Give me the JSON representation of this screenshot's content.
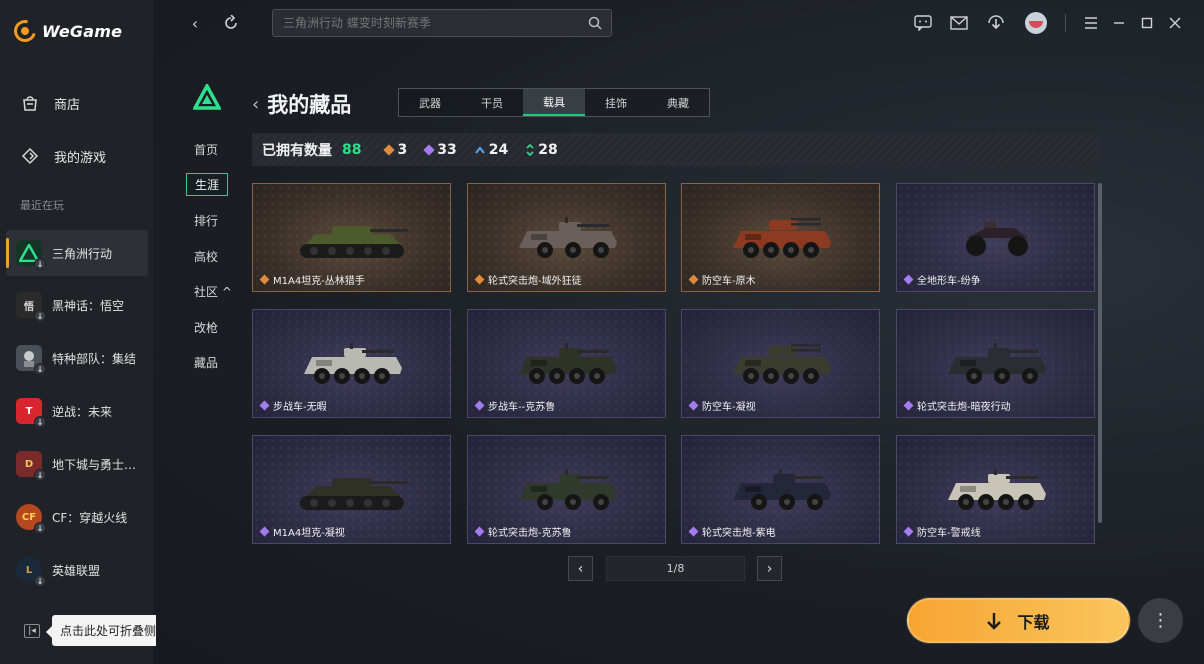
{
  "app": {
    "name": "WeGame"
  },
  "sidebar": {
    "nav": [
      {
        "label": "商店",
        "icon": "store-icon"
      },
      {
        "label": "我的游戏",
        "icon": "controller-icon"
      }
    ],
    "recent_label": "最近在玩",
    "games": [
      {
        "name": "三角洲行动",
        "active": true
      },
      {
        "name": "黑神话：悟空"
      },
      {
        "name": "特种部队：集结"
      },
      {
        "name": "逆战：未来"
      },
      {
        "name": "地下城与勇士：..."
      },
      {
        "name": "CF：穿越火线"
      },
      {
        "name": "英雄联盟"
      }
    ],
    "collapse_tooltip": "点击此处可折叠侧边栏"
  },
  "topbar": {
    "search_placeholder": "三角洲行动 蝶变时刻新赛季"
  },
  "game_nav": {
    "items": [
      "首页",
      "生涯",
      "排行",
      "高校",
      "社区 ^",
      "改枪",
      "藏品"
    ],
    "active": "生涯"
  },
  "collection": {
    "title": "我的藏品",
    "tabs": [
      "武器",
      "干员",
      "载具",
      "挂饰",
      "典藏"
    ],
    "active_tab": "载具",
    "owned_label": "已拥有数量",
    "owned_count": "88",
    "rarity_counts": [
      {
        "value": "3",
        "color": "#e08a3c"
      },
      {
        "value": "33",
        "color": "#a47cf0"
      },
      {
        "value": "24",
        "color": "#5aa8e6"
      },
      {
        "value": "28",
        "color": "#36d08a"
      }
    ],
    "items": [
      {
        "name": "M1A4坦克-丛林猎手",
        "rarity": "gold",
        "vehicle": "tank",
        "paint": "#4c5a2c"
      },
      {
        "name": "轮式突击炮-域外狂徒",
        "rarity": "gold",
        "vehicle": "assault",
        "paint": "#6a5f5a"
      },
      {
        "name": "防空车-原木",
        "rarity": "gold",
        "vehicle": "aa",
        "paint": "#8c3a22"
      },
      {
        "name": "全地形车-纷争",
        "rarity": "purple",
        "vehicle": "atv",
        "paint": "#2a2228"
      },
      {
        "name": "步战车-无暇",
        "rarity": "purple",
        "vehicle": "ifv",
        "paint": "#b9b9b4"
      },
      {
        "name": "步战车--克苏鲁",
        "rarity": "purple",
        "vehicle": "ifv",
        "paint": "#2e3328"
      },
      {
        "name": "防空车-凝视",
        "rarity": "purple",
        "vehicle": "aa",
        "paint": "#3a3c2e"
      },
      {
        "name": "轮式突击炮-暗夜行动",
        "rarity": "purple",
        "vehicle": "assault",
        "paint": "#2b2d33"
      },
      {
        "name": "M1A4坦克-凝视",
        "rarity": "purple",
        "vehicle": "tank",
        "paint": "#2f3127"
      },
      {
        "name": "轮式突击炮-克苏鲁",
        "rarity": "purple",
        "vehicle": "assault",
        "paint": "#2f3a2c"
      },
      {
        "name": "轮式突击炮-紫电",
        "rarity": "purple",
        "vehicle": "assault",
        "paint": "#24263a"
      },
      {
        "name": "防空车-警戒线",
        "rarity": "purple",
        "vehicle": "ifv",
        "paint": "#c9c4b8"
      }
    ],
    "pagination": "1/8"
  },
  "actions": {
    "download_label": "下载"
  }
}
